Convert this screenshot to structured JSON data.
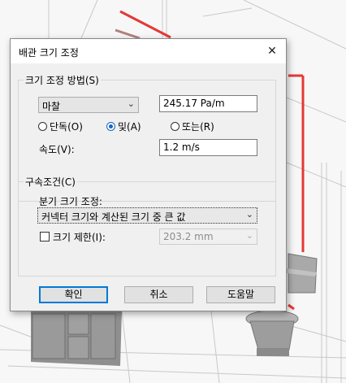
{
  "dialog": {
    "title": "배관 크기 조정",
    "close_glyph": "✕"
  },
  "sizing_method": {
    "legend": "크기 조정 방법(S)",
    "method_value": "마찰",
    "friction_value": "245.17 Pa/m",
    "radios": [
      {
        "label": "단독(O)",
        "selected": false
      },
      {
        "label": "및(A)",
        "selected": true
      },
      {
        "label": "또는(R)",
        "selected": false
      }
    ],
    "velocity_label": "속도(V):",
    "velocity_value": "1.2 m/s"
  },
  "constraints": {
    "legend": "구속조건(C)",
    "branch_label": "분기 크기 조정:",
    "branch_value": "커넥터 크기와 계산된 크기 중 큰 값",
    "limit_label": "크기 제한(I):",
    "limit_checked": false,
    "limit_value": "203.2 mm"
  },
  "buttons": {
    "ok": "확인",
    "cancel": "취소",
    "help": "도움말"
  }
}
